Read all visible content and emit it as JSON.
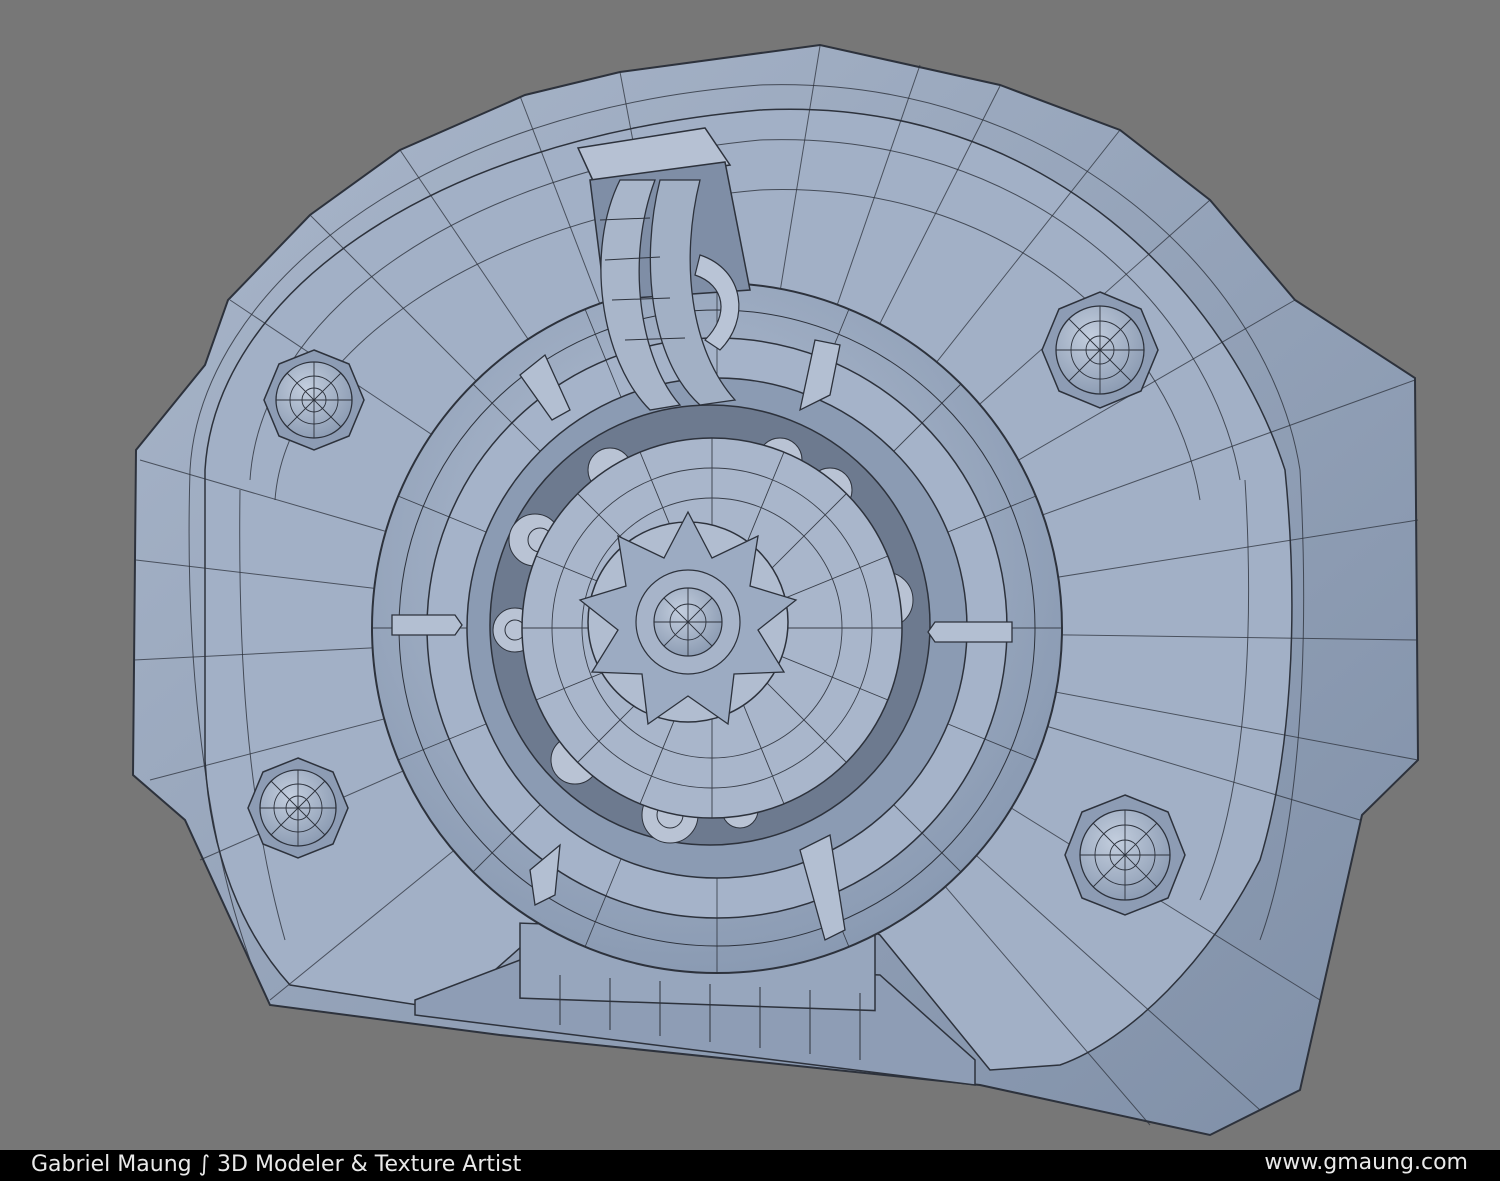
{
  "footer": {
    "credit": "Gabriel Maung ∫ 3D Modeler & Texture Artist",
    "website": "www.gmaung.com"
  },
  "colors": {
    "background": "#777777",
    "model": "#9aa9c1",
    "wire": "#2d323c",
    "footer": "#000000",
    "footer_text": "#e9e9e9"
  }
}
